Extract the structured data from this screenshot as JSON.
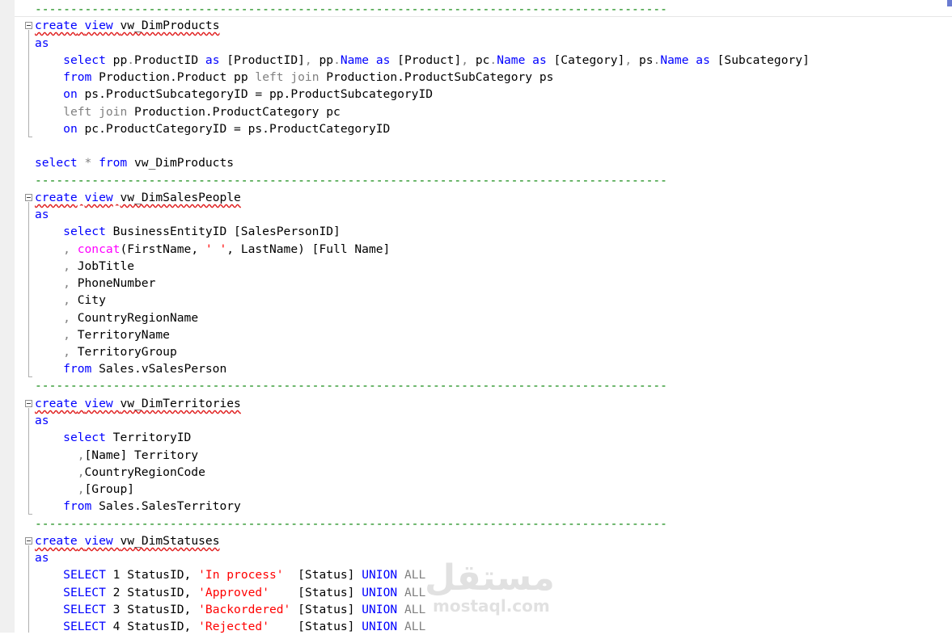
{
  "editor": {
    "separator": "-----------------------------------------------------------------------------------------",
    "products": {
      "create": "create",
      "view": "view",
      "name": "vw_DimProducts",
      "as": "as",
      "l1": [
        "select",
        " pp",
        ".",
        "ProductID ",
        "as",
        " [ProductID]",
        ",",
        " pp",
        ".",
        "Name",
        " as",
        " [Product]",
        ",",
        " pc",
        ".",
        "Name",
        " as",
        " [Category]",
        ",",
        " ps",
        ".",
        "Name",
        " as",
        " [Subcategory]"
      ],
      "l2_from": "from",
      "l2_rest": " Production.Product pp ",
      "l2_lj": "left join",
      "l2_tail": " Production.ProductSubCategory ps",
      "l3_on": "on",
      "l3_rest": " ps.ProductSubcategoryID = pp.ProductSubcategoryID",
      "l4_lj": "left join",
      "l4_rest": " Production.ProductCategory pc",
      "l5_on": "on",
      "l5_rest": " pc.ProductCategoryID = ps.ProductCategoryID"
    },
    "select_all": {
      "select": "select",
      "star": " * ",
      "from": "from",
      "rest": " vw_DimProducts"
    },
    "salespeople": {
      "create": "create",
      "view": "view",
      "name": "vw_DimSalesPeople",
      "as": "as",
      "select": "select",
      "entity": " BusinessEntityID [SalesPersonID]",
      "concat": "concat",
      "concat_args1": "(FirstName, ",
      "concat_str": "' '",
      "concat_args2": ", LastName) [Full Name]",
      "cols": [
        "JobTitle",
        "PhoneNumber",
        "City",
        "CountryRegionName",
        "TerritoryName",
        "TerritoryGroup"
      ],
      "from": "from",
      "from_rest": " Sales.vSalesPerson"
    },
    "territories": {
      "create": "create",
      "view": "view",
      "name": "vw_DimTerritories",
      "as": "as",
      "select": "select",
      "id": " TerritoryID",
      "c1": "[Name] Territory",
      "c2": "CountryRegionCode",
      "c3": "[Group]",
      "from": "from",
      "from_rest": " Sales.SalesTerritory"
    },
    "statuses": {
      "create": "create",
      "view": "view",
      "name": "vw_DimStatuses",
      "as": "as",
      "rows": [
        {
          "n": "1",
          "s": "'In process'",
          "pad": "  "
        },
        {
          "n": "2",
          "s": "'Approved'",
          "pad": "    "
        },
        {
          "n": "3",
          "s": "'Backordered'",
          "pad": " "
        },
        {
          "n": "4",
          "s": "'Rejected'",
          "pad": "    "
        }
      ],
      "select": "SELECT",
      "statusid": " StatusID, ",
      "status": "[Status] ",
      "union": "UNION",
      "all": " ALL"
    }
  },
  "watermark": {
    "arabic": "مستقل",
    "latin": "mostaql.com"
  },
  "colors": {
    "keyword": "#0000ff",
    "string": "#ff0000",
    "function": "#ff00ff",
    "comment": "#008000",
    "operator": "#808080"
  }
}
